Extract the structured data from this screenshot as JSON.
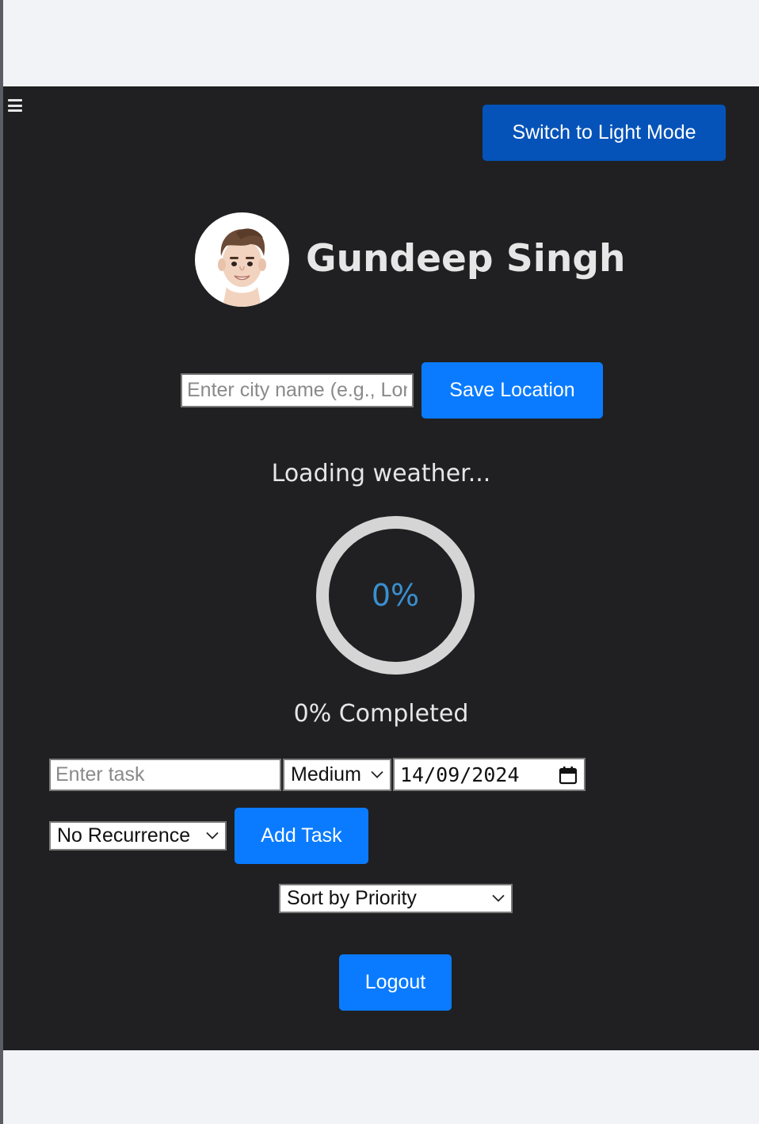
{
  "header": {
    "menu_icon": "hamburger-icon",
    "theme_toggle_label": "Switch to Light Mode"
  },
  "profile": {
    "name": "Gundeep Singh",
    "avatar_icon": "memoji-avatar"
  },
  "location": {
    "city_placeholder": "Enter city name (e.g., London)",
    "save_label": "Save Location"
  },
  "weather": {
    "status": "Loading weather..."
  },
  "progress": {
    "percent_text": "0%",
    "value": 0,
    "completed_label": "0% Completed"
  },
  "task_form": {
    "task_placeholder": "Enter task",
    "priority_selected": "Medium",
    "due_date": "14/09/2024",
    "recurrence_selected": "No Recurrence",
    "add_label": "Add Task"
  },
  "sort": {
    "selected": "Sort by Priority"
  },
  "logout_label": "Logout",
  "colors": {
    "panel_bg": "#202022",
    "primary_button": "#0a7bff",
    "theme_button": "#0553b8",
    "progress_text": "#3a8fd0",
    "page_bg": "#f2f3f7"
  }
}
